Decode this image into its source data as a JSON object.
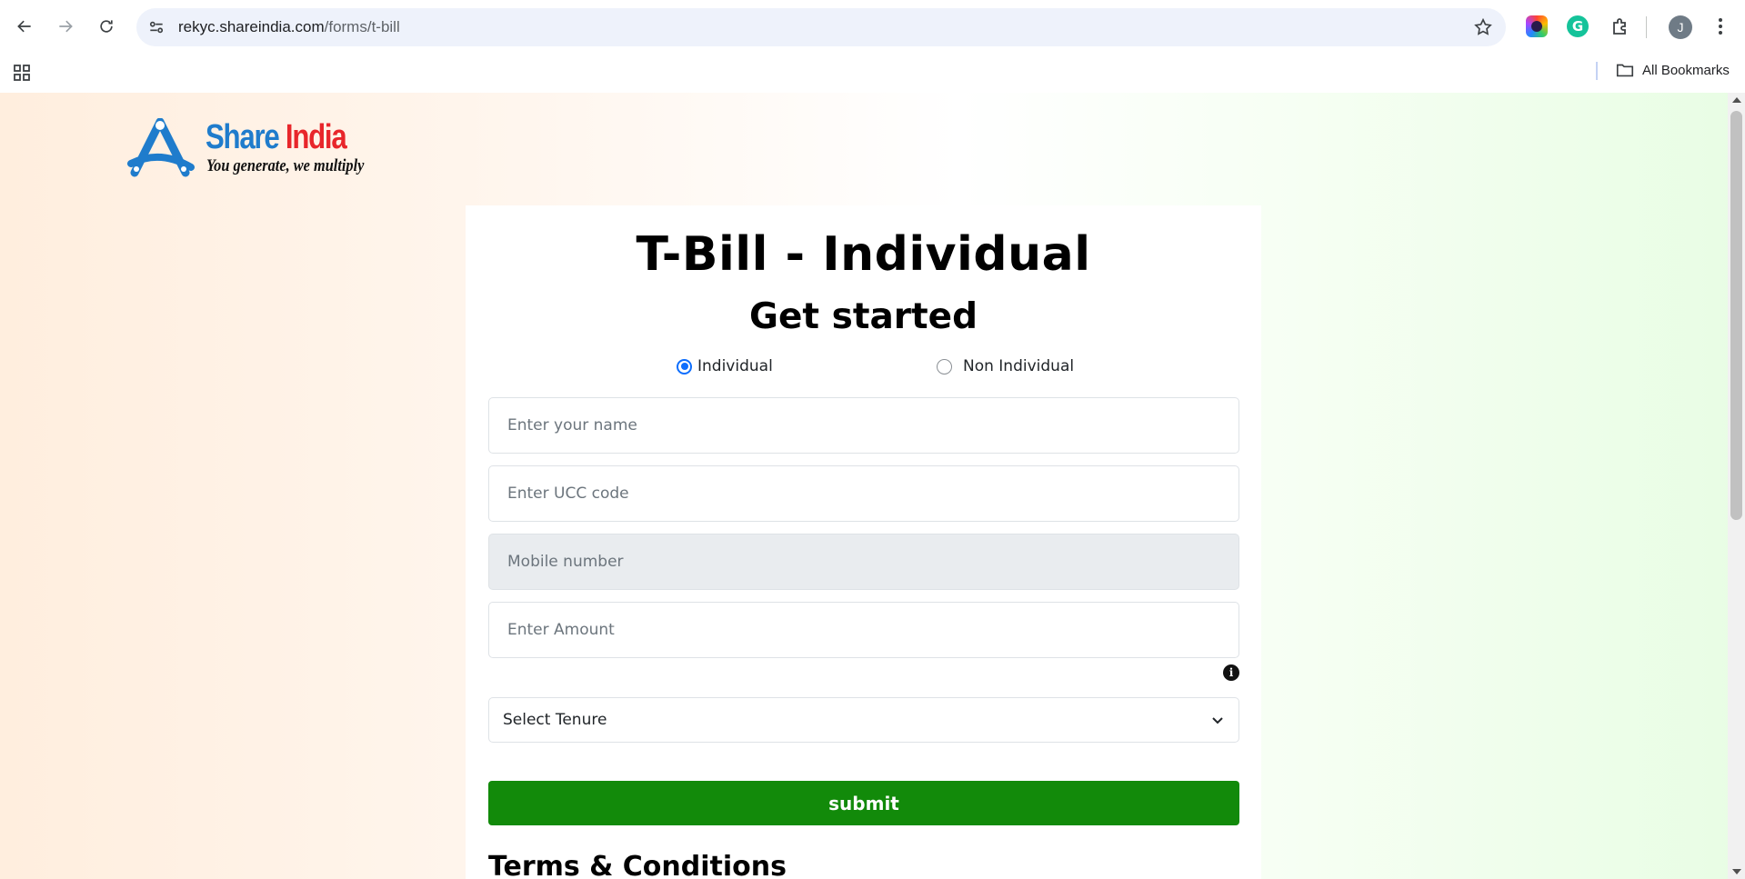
{
  "browser": {
    "url_domain": "rekyc.shareindia.com",
    "url_path": "/forms/t-bill",
    "profile_initial": "J",
    "bookmarks_label": "All Bookmarks",
    "icons": [
      "back-icon",
      "forward-icon",
      "reload-icon",
      "site-settings-icon",
      "star-icon",
      "extension-icon",
      "kebab-menu-icon",
      "apps-icon",
      "folder-icon"
    ]
  },
  "logo": {
    "word1": "Share",
    "word2": "India",
    "tagline": "You generate, we multiply",
    "colors": {
      "blue": "#1f7ccc",
      "red": "#e8262b"
    }
  },
  "form": {
    "title": "T-Bill - Individual",
    "subtitle": "Get started",
    "radio_options": [
      {
        "label": "Individual",
        "checked": true
      },
      {
        "label": "Non Individual",
        "checked": false
      }
    ],
    "fields": {
      "name_placeholder": "Enter your name",
      "ucc_placeholder": "Enter UCC code",
      "mobile_placeholder": "Mobile number",
      "amount_placeholder": "Enter Amount"
    },
    "tenure_select": "Select Tenure",
    "submit_label": "submit",
    "terms_heading": "Terms & Conditions",
    "submit_color": "#128a0a"
  }
}
